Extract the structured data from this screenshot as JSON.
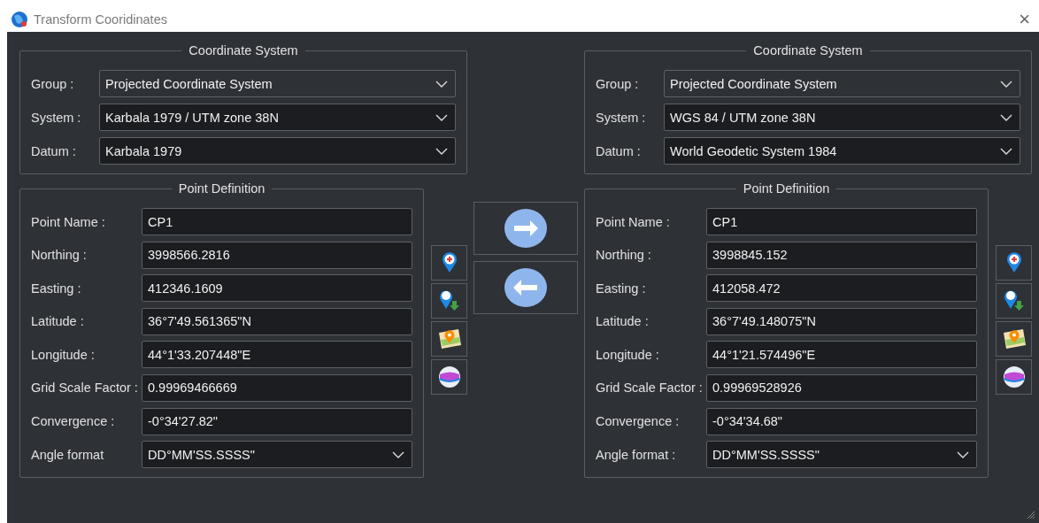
{
  "window": {
    "title": "Transform Cooridinates",
    "close": "×"
  },
  "panels": [
    {
      "coordinate_system": {
        "title": "Coordinate System",
        "rows": [
          {
            "label": "Group :",
            "value": "Projected Coordinate System",
            "disabled": true
          },
          {
            "label": "System :",
            "value": "Karbala 1979 / UTM zone 38N",
            "disabled": false
          },
          {
            "label": "Datum :",
            "value": "Karbala 1979",
            "disabled": false
          }
        ]
      },
      "point_definition": {
        "title": "Point Definition",
        "rows": [
          {
            "kind": "input",
            "label": "Point Name :",
            "value": "CP1"
          },
          {
            "kind": "input",
            "label": "Northing :",
            "value": "3998566.2816"
          },
          {
            "kind": "input",
            "label": "Easting :",
            "value": "412346.1609"
          },
          {
            "kind": "input",
            "label": "Latitude :",
            "value": "36°7'49.561365\"N"
          },
          {
            "kind": "input",
            "label": "Longitude :",
            "value": "44°1'33.207448\"E"
          },
          {
            "kind": "input",
            "label": "Grid Scale Factor :",
            "value": "0.99969466669"
          },
          {
            "kind": "input",
            "label": "Convergence :",
            "value": "-0°34'27.82\""
          },
          {
            "kind": "select",
            "label": "Angle format",
            "value": "DD°MM'SS.SSSS\""
          }
        ]
      }
    },
    {
      "coordinate_system": {
        "title": "Coordinate System",
        "rows": [
          {
            "label": "Group :",
            "value": "Projected Coordinate System",
            "disabled": true
          },
          {
            "label": "System :",
            "value": "WGS 84 / UTM zone 38N",
            "disabled": false
          },
          {
            "label": "Datum :",
            "value": "World Geodetic System 1984",
            "disabled": false
          }
        ]
      },
      "point_definition": {
        "title": "Point Definition",
        "rows": [
          {
            "kind": "input",
            "label": "Point Name :",
            "value": "CP1"
          },
          {
            "kind": "input",
            "label": "Northing :",
            "value": "3998845.152"
          },
          {
            "kind": "input",
            "label": "Easting :",
            "value": "412058.472"
          },
          {
            "kind": "input",
            "label": "Latitude :",
            "value": "36°7'49.148075\"N"
          },
          {
            "kind": "input",
            "label": "Longitude :",
            "value": "44°1'21.574496\"E"
          },
          {
            "kind": "input",
            "label": "Grid Scale Factor :",
            "value": "0.99969528926"
          },
          {
            "kind": "input",
            "label": "Convergence :",
            "value": "-0°34'34.68\""
          },
          {
            "kind": "select",
            "label": "Angle format :",
            "value": "DD°MM'SS.SSSS\""
          }
        ]
      }
    }
  ]
}
